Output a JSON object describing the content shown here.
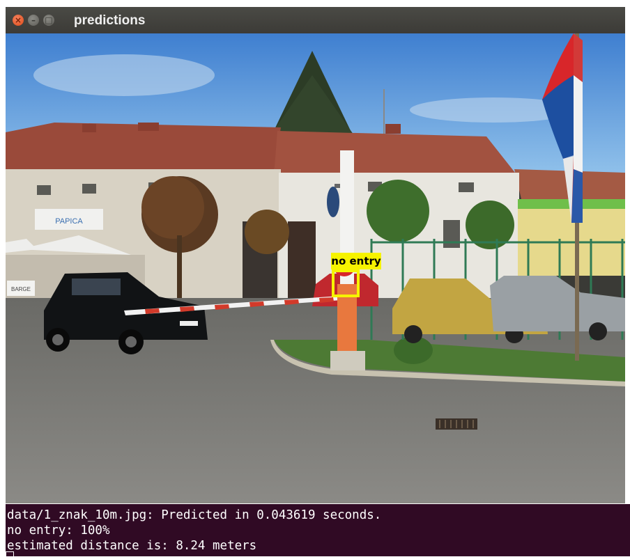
{
  "window": {
    "title": "predictions",
    "controls": {
      "close": "×",
      "minimize": "–",
      "maximize": "□"
    }
  },
  "detection": {
    "label": "no entry",
    "box_color": "#f6f300"
  },
  "terminal": {
    "lines": [
      "data/1_znak_10m.jpg: Predicted in 0.043619 seconds.",
      "no entry: 100%",
      "estimated distance is: 8.24 meters"
    ],
    "background": "#300a24"
  },
  "scene": {
    "shop_sign": "PAPICA",
    "small_sign": "BARGE"
  }
}
